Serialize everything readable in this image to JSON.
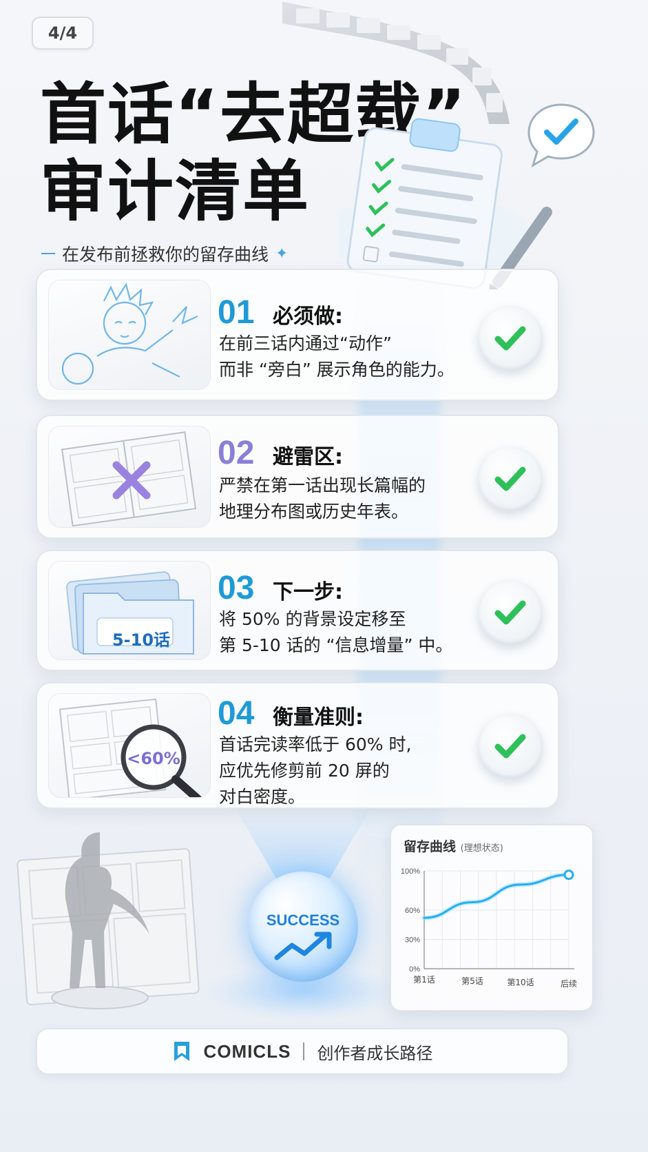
{
  "page_indicator": "4/4",
  "title": {
    "line1": "首话“去超载”",
    "line2": "审计清单"
  },
  "subtitle": "在发布前拯救你的留存曲线",
  "items": [
    {
      "num": "01",
      "heading": "必须做:",
      "lines": [
        "在前三话内通过“动作”",
        "而非 “旁白” 展示角色的能力。"
      ],
      "num_color": "#1f9ad6"
    },
    {
      "num": "02",
      "heading": "避雷区:",
      "lines": [
        "严禁在第一话出现长篇幅的",
        "地理分布图或历史年表。"
      ],
      "num_color": "#8a7fd6"
    },
    {
      "num": "03",
      "heading": "下一步:",
      "lines": [
        "将 50% 的背景设定移至",
        "第 5-10 话的 “信息增量” 中。"
      ],
      "num_color": "#1f9ad6",
      "thumb_label": "5-10话"
    },
    {
      "num": "04",
      "heading": "衡量准则:",
      "lines": [
        "首话完读率低于 60% 时,",
        "应优先修剪前 20 屏的",
        "对白密度。"
      ],
      "num_color": "#1f9ad6",
      "thumb_label": "<60%"
    }
  ],
  "success_label": "SUCCESS",
  "chart_data": {
    "type": "line",
    "title": "留存曲线",
    "subtitle": "(理想状态)",
    "categories": [
      "第1话",
      "第5话",
      "第10话",
      "后续"
    ],
    "y_ticks": [
      "100%",
      "60%",
      "30%",
      "0%"
    ],
    "ylim": [
      0,
      100
    ],
    "series": [
      {
        "values": [
          52,
          68,
          86,
          96
        ]
      }
    ],
    "grid": true
  },
  "footer": {
    "brand": "COMICLS",
    "tagline": "创作者成长路径"
  },
  "colors": {
    "accent_blue": "#1f9ad6",
    "accent_purple": "#8a7fd6",
    "check_green": "#2ec05a"
  }
}
